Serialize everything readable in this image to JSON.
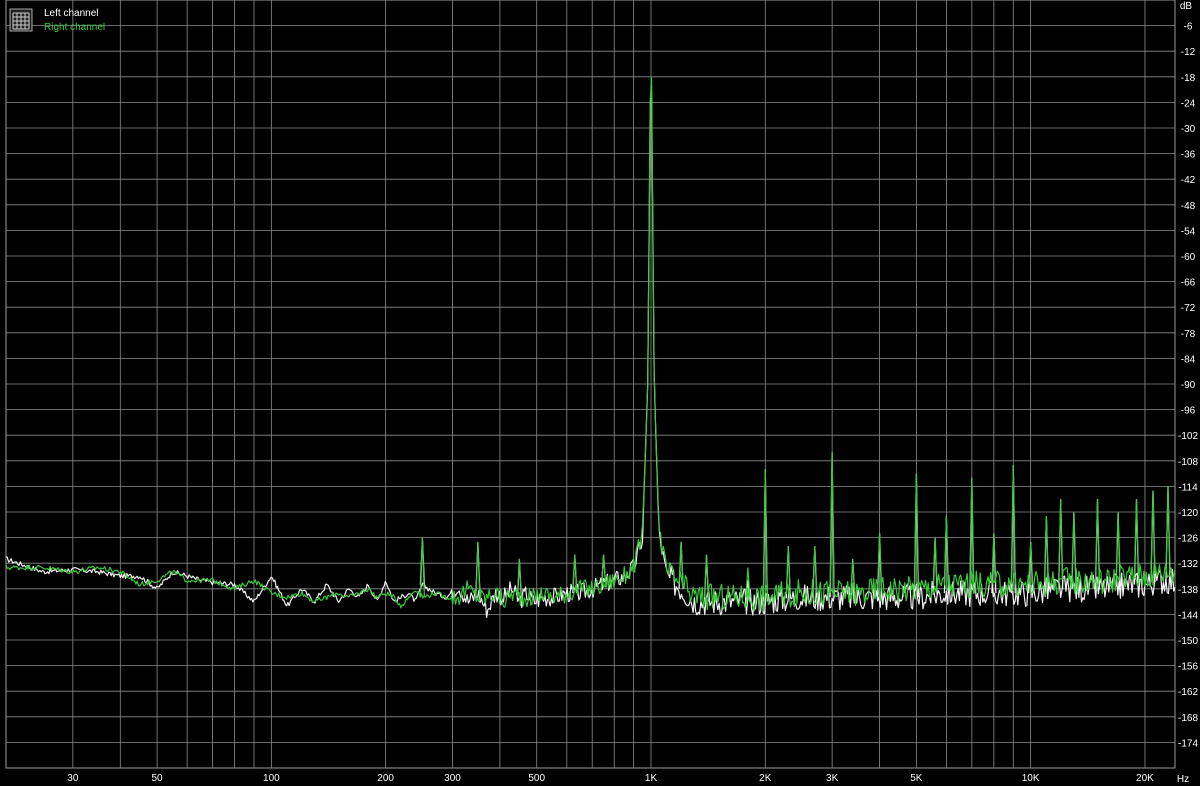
{
  "chart_data": {
    "type": "line",
    "title": "",
    "xlabel": "",
    "ylabel": "",
    "x_unit": "Hz",
    "y_unit": "dB",
    "xscale": "log",
    "xlim": [
      20,
      24000
    ],
    "ylim": [
      -180,
      0
    ],
    "grid": true,
    "legend_position": "top-left",
    "background_color": "#000000",
    "grid_color": "#8c8c8c",
    "x_ticks": [
      {
        "value": 30,
        "label": "30"
      },
      {
        "value": 50,
        "label": "50"
      },
      {
        "value": 100,
        "label": "100"
      },
      {
        "value": 200,
        "label": "200"
      },
      {
        "value": 300,
        "label": "300"
      },
      {
        "value": 500,
        "label": "500"
      },
      {
        "value": 1000,
        "label": "1K"
      },
      {
        "value": 2000,
        "label": "2K"
      },
      {
        "value": 3000,
        "label": "3K"
      },
      {
        "value": 5000,
        "label": "5K"
      },
      {
        "value": 10000,
        "label": "10K"
      },
      {
        "value": 20000,
        "label": "20K"
      }
    ],
    "x_grid": [
      20,
      30,
      40,
      50,
      60,
      70,
      80,
      90,
      100,
      200,
      300,
      400,
      500,
      600,
      700,
      800,
      900,
      1000,
      2000,
      3000,
      4000,
      5000,
      6000,
      7000,
      8000,
      9000,
      10000,
      20000
    ],
    "y_ticks": [
      -6,
      -12,
      -18,
      -24,
      -30,
      -36,
      -42,
      -48,
      -54,
      -60,
      -66,
      -72,
      -78,
      -84,
      -90,
      -96,
      -102,
      -108,
      -114,
      -120,
      -126,
      -132,
      -138,
      -144,
      -150,
      -156,
      -162,
      -168,
      -174
    ],
    "series": [
      {
        "name": "Left channel",
        "color": "#ffffff",
        "x": [
          20,
          25,
          30,
          35,
          40,
          45,
          50,
          55,
          60,
          65,
          70,
          80,
          90,
          100,
          110,
          120,
          130,
          140,
          150,
          160,
          170,
          180,
          190,
          200,
          210,
          220,
          230,
          240,
          250,
          270,
          290,
          310,
          330,
          350,
          370,
          390,
          410,
          430,
          450,
          470,
          490,
          520,
          550,
          600,
          650,
          700,
          750,
          800,
          850,
          900,
          950,
          980,
          1000,
          1020,
          1050,
          1100,
          1200,
          1300,
          1400,
          1600,
          1800,
          2000,
          2400,
          2800,
          3200,
          3600,
          4000,
          5000,
          6000,
          7000,
          8000,
          10000,
          12000,
          14000,
          16000,
          18000,
          20000,
          22000,
          24000
        ],
        "y": [
          -131,
          -134,
          -133.5,
          -134,
          -135,
          -135,
          -138,
          -134,
          -135,
          -136,
          -136.5,
          -137,
          -141,
          -135,
          -142,
          -138,
          -141,
          -137,
          -141,
          -138,
          -140,
          -137,
          -141,
          -136,
          -141,
          -140,
          -139,
          -141,
          -137,
          -139,
          -140,
          -137,
          -141,
          -139,
          -143,
          -139,
          -140,
          -138,
          -141,
          -139,
          -141,
          -140,
          -140,
          -139,
          -139,
          -138,
          -137,
          -136,
          -135,
          -133,
          -126,
          -90,
          -6,
          -90,
          -125,
          -135,
          -138,
          -141,
          -141,
          -141,
          -141,
          -141,
          -140,
          -140,
          -140,
          -140,
          -140,
          -140,
          -139,
          -139,
          -139,
          -139,
          -138,
          -138,
          -138,
          -137,
          -137,
          -136,
          -136
        ]
      },
      {
        "name": "Right channel",
        "color": "#3cc83c",
        "x": [
          20,
          25,
          30,
          35,
          40,
          45,
          50,
          55,
          60,
          65,
          70,
          80,
          90,
          100,
          110,
          120,
          130,
          140,
          150,
          160,
          170,
          180,
          190,
          200,
          210,
          220,
          230,
          240,
          250,
          270,
          290,
          310,
          330,
          350,
          370,
          390,
          410,
          430,
          450,
          470,
          490,
          520,
          550,
          600,
          650,
          700,
          750,
          800,
          850,
          900,
          950,
          980,
          1000,
          1020,
          1050,
          1100,
          1200,
          1300,
          1400,
          1600,
          1800,
          2000,
          2400,
          2800,
          3200,
          3600,
          4000,
          5000,
          6000,
          7000,
          8000,
          10000,
          12000,
          14000,
          16000,
          18000,
          20000,
          22000,
          24000
        ],
        "y": [
          -133,
          -133,
          -134,
          -133,
          -134,
          -137,
          -136,
          -134,
          -136,
          -136,
          -136,
          -138,
          -136,
          -139,
          -140,
          -139,
          -141,
          -140,
          -139,
          -140,
          -139,
          -138,
          -140,
          -139,
          -140,
          -142,
          -140,
          -138,
          -140,
          -139,
          -140,
          -140,
          -138,
          -140,
          -140,
          -139,
          -141,
          -139,
          -140,
          -140,
          -140,
          -139,
          -140,
          -139,
          -138,
          -138,
          -137,
          -136,
          -135,
          -133,
          -125,
          -90,
          -4,
          -90,
          -124,
          -134,
          -137,
          -140,
          -140,
          -140,
          -140,
          -140,
          -139,
          -139,
          -139,
          -139,
          -138,
          -138,
          -137,
          -137,
          -137,
          -137,
          -136,
          -136,
          -136,
          -135,
          -135,
          -134,
          -134
        ]
      }
    ],
    "harmonic_peaks": [
      {
        "freq": 250,
        "left": -126,
        "right": -126
      },
      {
        "freq": 350,
        "left": -127,
        "right": -127
      },
      {
        "freq": 450,
        "left": -131,
        "right": -131
      },
      {
        "freq": 630,
        "left": -130,
        "right": -130
      },
      {
        "freq": 750,
        "left": -130,
        "right": -130
      },
      {
        "freq": 1200,
        "left": -127,
        "right": -127
      },
      {
        "freq": 1400,
        "left": -130,
        "right": -130
      },
      {
        "freq": 1800,
        "left": -136,
        "right": -133
      },
      {
        "freq": 2000,
        "left": -110,
        "right": -110
      },
      {
        "freq": 2300,
        "left": -128,
        "right": -128
      },
      {
        "freq": 2700,
        "left": -128,
        "right": -128
      },
      {
        "freq": 3000,
        "left": -106,
        "right": -106
      },
      {
        "freq": 3400,
        "left": -131,
        "right": -131
      },
      {
        "freq": 4000,
        "left": -125,
        "right": -125
      },
      {
        "freq": 5000,
        "left": -111,
        "right": -111
      },
      {
        "freq": 5600,
        "left": -126,
        "right": -126
      },
      {
        "freq": 6000,
        "left": -121,
        "right": -121
      },
      {
        "freq": 7000,
        "left": -112,
        "right": -112
      },
      {
        "freq": 8000,
        "left": -125,
        "right": -125
      },
      {
        "freq": 9000,
        "left": -109,
        "right": -109
      },
      {
        "freq": 10000,
        "left": -127,
        "right": -127
      },
      {
        "freq": 11000,
        "left": -121,
        "right": -121
      },
      {
        "freq": 12000,
        "left": -117,
        "right": -117
      },
      {
        "freq": 13000,
        "left": -120,
        "right": -120
      },
      {
        "freq": 15000,
        "left": -117,
        "right": -117
      },
      {
        "freq": 17000,
        "left": -120,
        "right": -120
      },
      {
        "freq": 19000,
        "left": -117,
        "right": -117
      },
      {
        "freq": 21000,
        "left": -115,
        "right": -115
      },
      {
        "freq": 23000,
        "left": -114,
        "right": -114
      }
    ]
  },
  "legend": {
    "items": [
      {
        "label": "Left channel",
        "color": "#ffffff"
      },
      {
        "label": "Right channel",
        "color": "#3cc83c"
      }
    ],
    "icon": "grid-chart-icon"
  },
  "axes": {
    "y_unit_label": "dB",
    "x_unit_label": "Hz"
  }
}
